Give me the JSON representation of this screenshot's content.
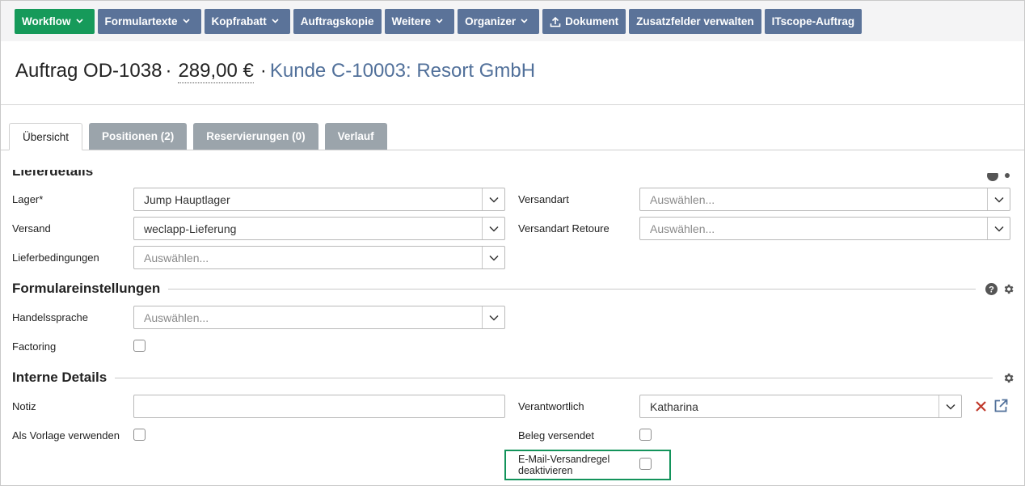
{
  "toolbar": {
    "workflow": "Workflow",
    "formulartexte": "Formulartexte",
    "kopfrabatt": "Kopfrabatt",
    "auftragskopie": "Auftragskopie",
    "weitere": "Weitere",
    "organizer": "Organizer",
    "dokument": "Dokument",
    "zusatzfelder": "Zusatzfelder verwalten",
    "itscope": "ITscope-Auftrag"
  },
  "header": {
    "order": "Auftrag OD-1038",
    "dot1": "·",
    "amount": "289,00 €",
    "dot2": "·",
    "customer": "Kunde C-10003: Resort GmbH"
  },
  "tabs": [
    {
      "label": "Übersicht",
      "active": true
    },
    {
      "label": "Positionen (2)"
    },
    {
      "label": "Reservierungen (0)"
    },
    {
      "label": "Verlauf"
    }
  ],
  "lieferdetails": {
    "heading": "Lieferdetails",
    "lager_label": "Lager*",
    "lager_value": "Jump Hauptlager",
    "versand_label": "Versand",
    "versand_value": "weclapp-Lieferung",
    "lieferbedingungen_label": "Lieferbedingungen",
    "lieferbedingungen_placeholder": "Auswählen...",
    "versandart_label": "Versandart",
    "versandart_placeholder": "Auswählen...",
    "versandart_retoure_label": "Versandart Retoure",
    "versandart_retoure_placeholder": "Auswählen..."
  },
  "formulareinstellungen": {
    "heading": "Formulareinstellungen",
    "handelssprache_label": "Handelssprache",
    "handelssprache_placeholder": "Auswählen...",
    "factoring_label": "Factoring",
    "factoring_checked": false
  },
  "interne_details": {
    "heading": "Interne Details",
    "notiz_label": "Notiz",
    "notiz_value": "",
    "vorlage_label": "Als Vorlage verwenden",
    "vorlage_checked": false,
    "verantwortlich_label": "Verantwortlich",
    "verantwortlich_value": "Katharina",
    "beleg_versendet_label": "Beleg versendet",
    "beleg_versendet_checked": false,
    "email_regel_label_line1": "E-Mail-Versandregel",
    "email_regel_label_line2": "deaktivieren",
    "email_regel_checked": false
  },
  "colors": {
    "toolbar_button": "#5b7399",
    "workflow_button": "#169a5a",
    "customer_link": "#51709a",
    "tab_inactive": "#9ba4ab",
    "remove_icon": "#c0392b",
    "highlight": "#13935b"
  },
  "icons": {
    "help": "help-icon",
    "settings": "gear-icon",
    "remove": "close-icon",
    "open": "external-link-icon",
    "upload": "upload-icon",
    "dropdown": "chevron-down-icon"
  }
}
